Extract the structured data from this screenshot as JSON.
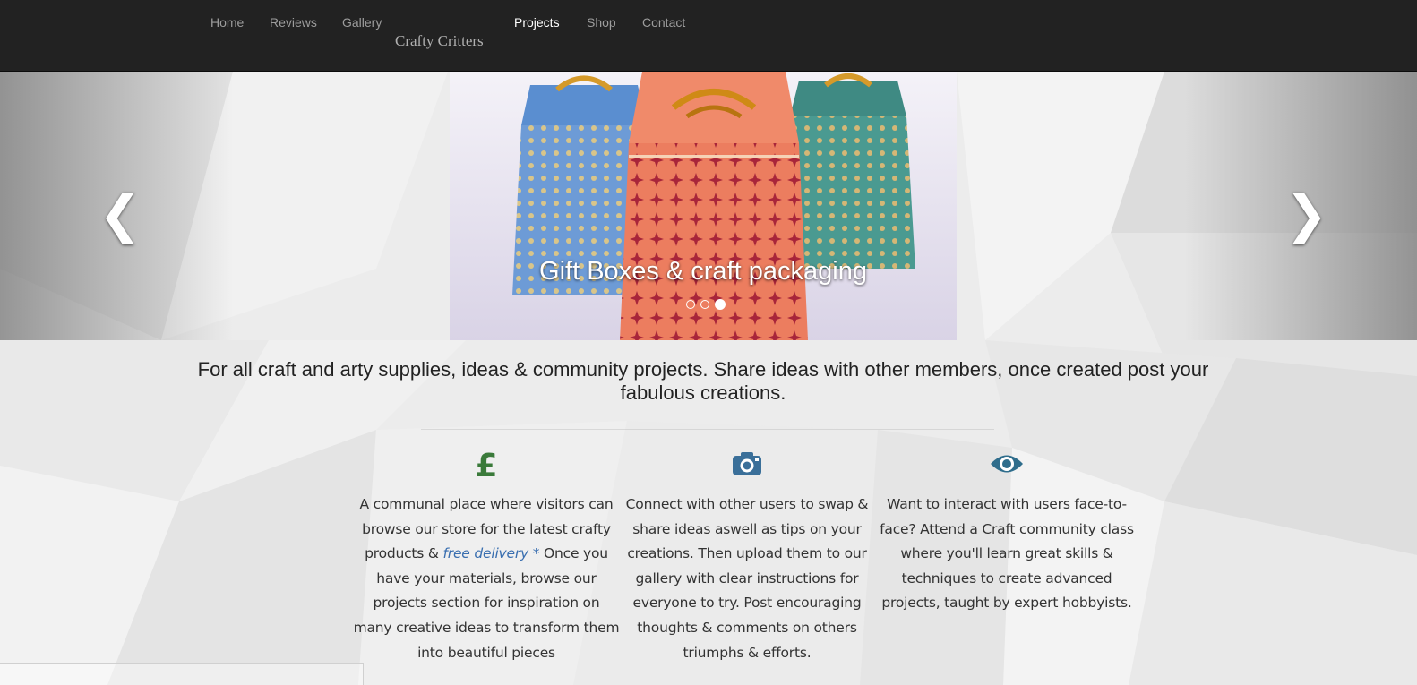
{
  "navbar": {
    "brand": "Crafty Critters",
    "links": [
      {
        "label": "Home",
        "active": false
      },
      {
        "label": "Reviews",
        "active": false
      },
      {
        "label": "Gallery",
        "active": false
      },
      {
        "label": "Projects",
        "active": true
      },
      {
        "label": "Shop",
        "active": false
      },
      {
        "label": "Contact",
        "active": false
      }
    ]
  },
  "carousel": {
    "caption": "Gift Boxes & craft packaging",
    "indicators": 3,
    "active_indicator": 3,
    "prev_glyph": "❮",
    "next_glyph": "❯"
  },
  "intro": {
    "text": "For all craft and arty supplies, ideas & community projects. Share ideas with other members, once created post your fabulous creations."
  },
  "features": [
    {
      "icon": "pound-icon",
      "icon_color": "#3a7a3a",
      "text_before": "A communal place where visitors can browse our store for the latest crafty products & ",
      "link": "free delivery *",
      "text_after": " Once you have your materials, browse our projects section for inspiration on many creative ideas to transform them into beautiful pieces"
    },
    {
      "icon": "camera-icon",
      "icon_color": "#3a6f99",
      "text": "Connect with other users to swap & share ideas aswell as tips on your creations. Then upload them to our gallery with clear instructions for everyone to try. Post encouraging thoughts & comments on others triumphs & efforts."
    },
    {
      "icon": "eye-icon",
      "icon_color": "#2f6d8c",
      "text": "Want to interact with users face-to-face? Attend a Craft community class where you'll learn great skills & techniques to create advanced projects, taught by expert hobbyists."
    }
  ],
  "colors": {
    "navbar_bg": "#222222",
    "nav_text": "#9d9d9d",
    "nav_active": "#ffffff",
    "link": "#3a6fb0"
  }
}
